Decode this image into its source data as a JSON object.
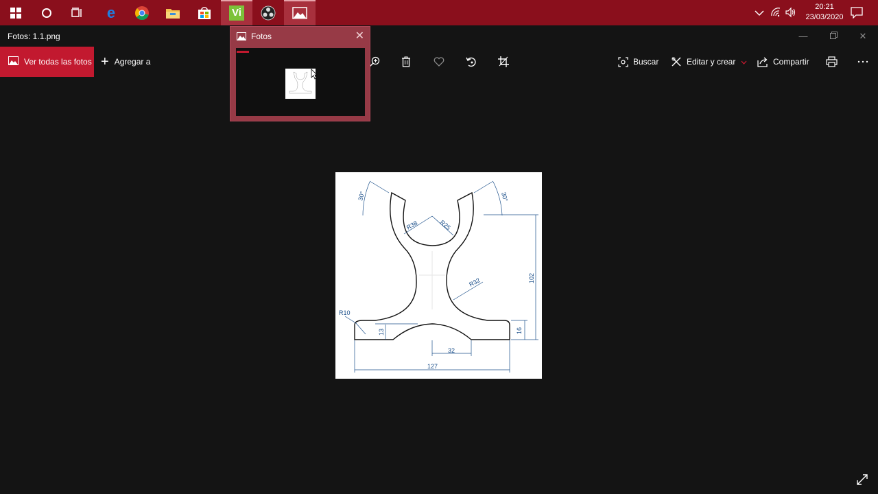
{
  "taskbar": {
    "apps": [
      {
        "name": "windows-start-icon"
      },
      {
        "name": "cortana-icon"
      },
      {
        "name": "task-view-icon"
      },
      {
        "name": "edge-icon"
      },
      {
        "name": "chrome-icon"
      },
      {
        "name": "file-explorer-icon"
      },
      {
        "name": "store-icon"
      },
      {
        "name": "vi-app-icon",
        "label": "Vi"
      },
      {
        "name": "obs-icon"
      },
      {
        "name": "photos-icon"
      }
    ],
    "time": "20:21",
    "date": "23/03/2020"
  },
  "window": {
    "title": "Fotos: 1.1.png"
  },
  "commandbar": {
    "view_all": "Ver todas las fotos",
    "add_to": "Agregar a",
    "search": "Buscar",
    "edit_create": "Editar y crear",
    "share": "Compartir"
  },
  "popup": {
    "title": "Fotos"
  },
  "drawing": {
    "angle_left": "30°",
    "angle_right": "30°",
    "r38": "R38",
    "r25": "R25",
    "r32": "R32",
    "r10": "R10",
    "height_102": "102",
    "dim_13": "13",
    "dim_16": "16",
    "dim_32": "32",
    "dim_127": "127"
  },
  "colors": {
    "accent": "#c2192f",
    "taskbar": "#8a0f1c",
    "dimension_text": "#1b4f8a"
  }
}
